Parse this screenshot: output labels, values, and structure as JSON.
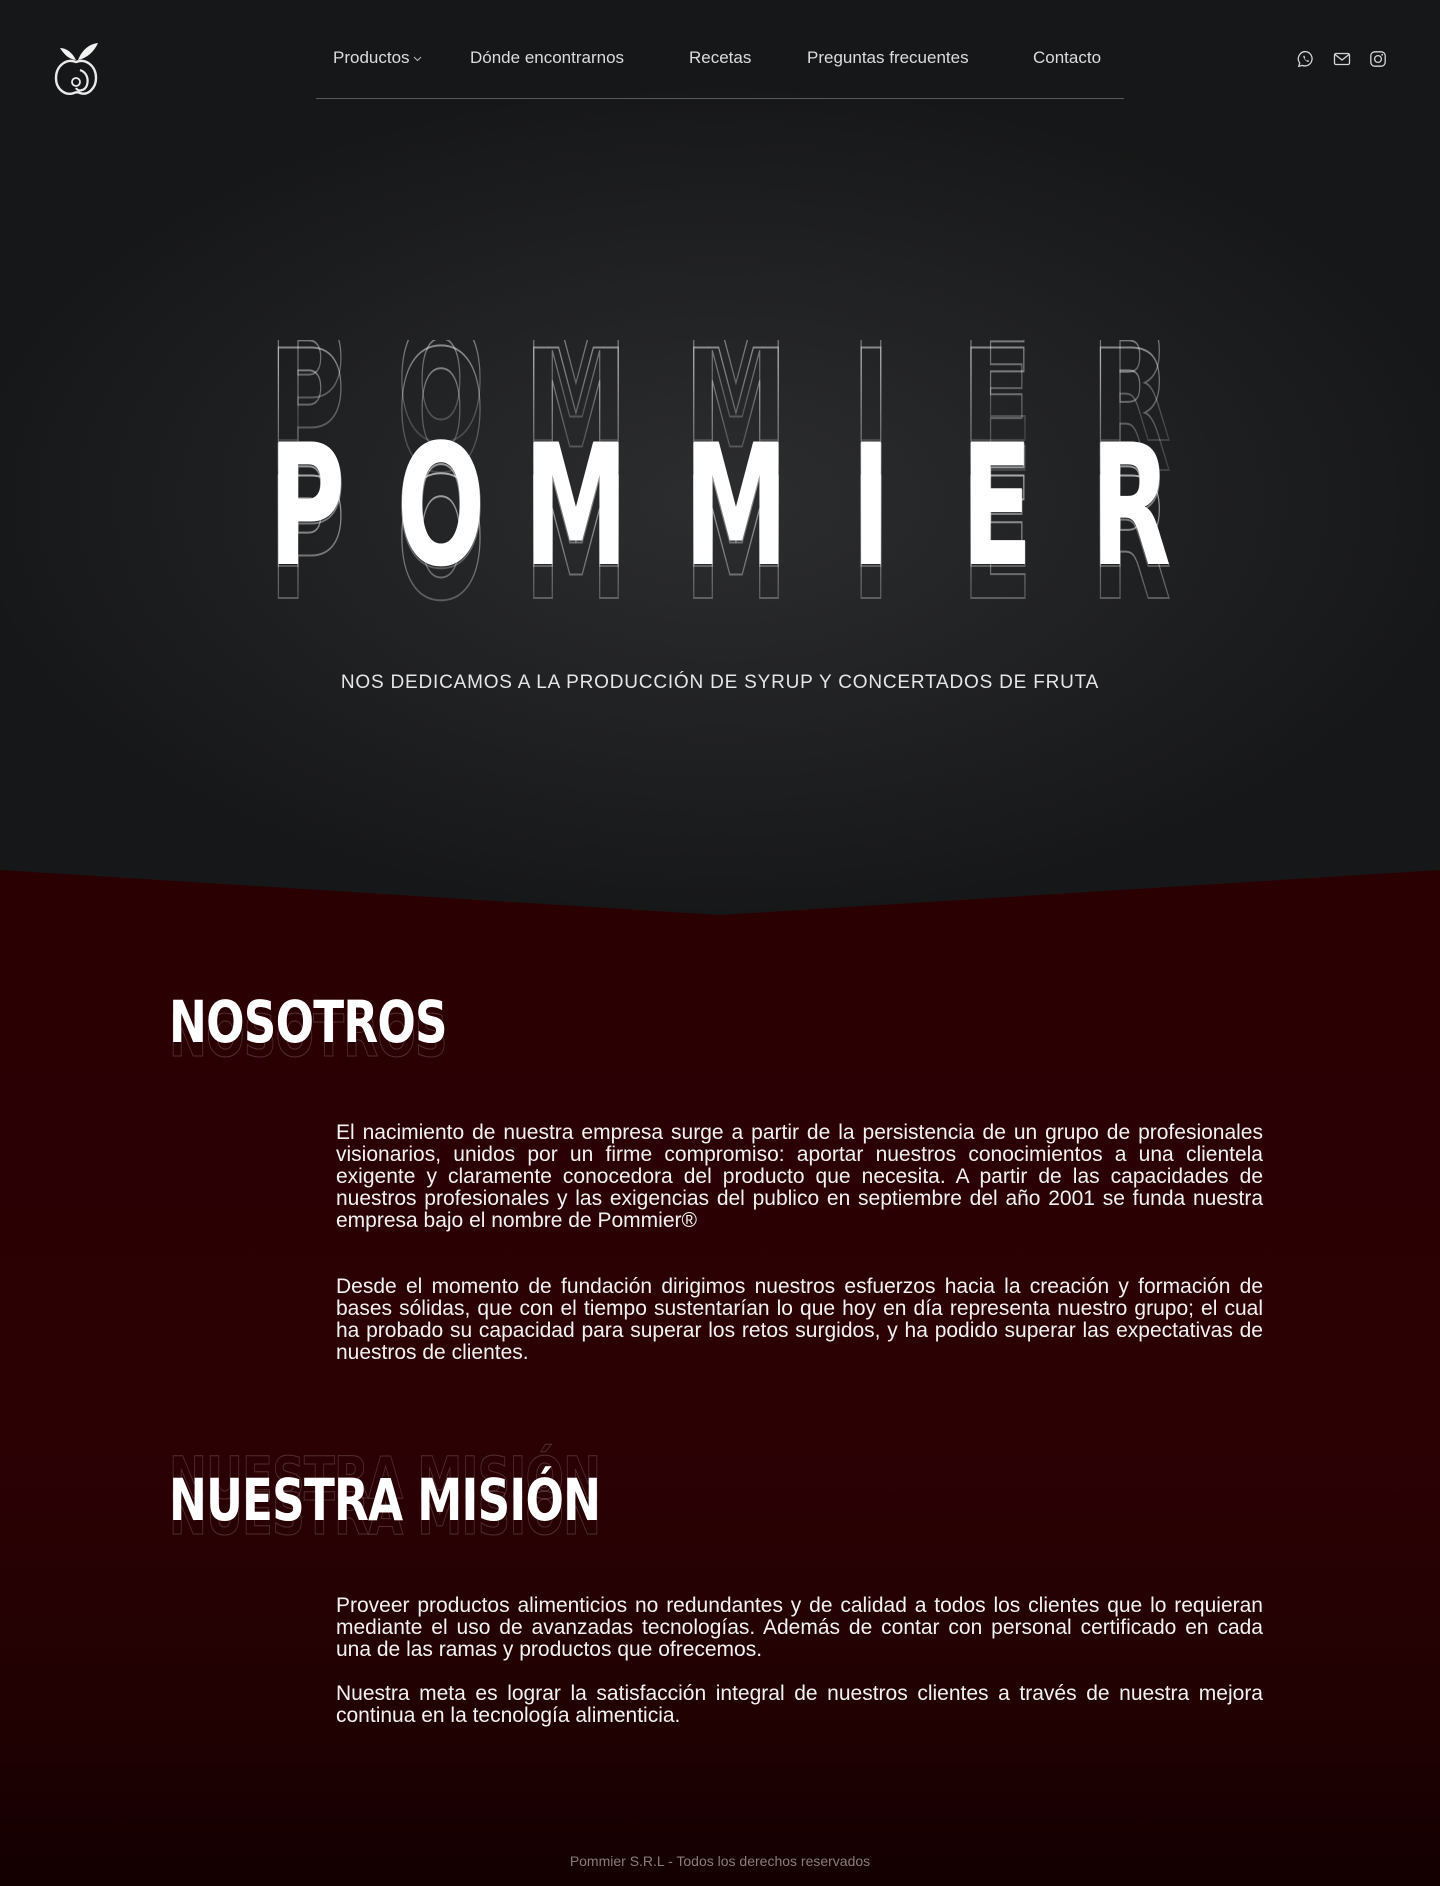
{
  "nav": {
    "items": [
      {
        "label": "Productos",
        "has_dropdown": true
      },
      {
        "label": "Dónde encontrarnos"
      },
      {
        "label": "Recetas"
      },
      {
        "label": "Preguntas frecuentes"
      },
      {
        "label": "Contacto"
      }
    ],
    "social_icons": [
      "whatsapp-icon",
      "mail-icon",
      "instagram-icon"
    ]
  },
  "hero": {
    "brand": "POMMIER",
    "tagline": "NOS DEDICAMOS A LA PRODUCCIÓN DE SYRUP Y CONCERTADOS DE FRUTA"
  },
  "about": {
    "title": "NOSOTROS",
    "paragraphs": [
      "El nacimiento de nuestra empresa surge a partir de la persistencia de un grupo de profesionales visionarios, unidos por un firme compromiso: aportar nuestros conocimientos a una clientela exigente y claramente conocedora del producto que necesita. A partir de las capacidades de nuestros profesionales y las exigencias del publico en septiembre del año 2001 se funda nuestra empresa bajo el nombre de Pommier®",
      "Desde el momento de fundación dirigimos nuestros esfuerzos hacia la creación y formación de bases sólidas, que con el tiempo sustentarían lo que hoy en día representa nuestro grupo; el cual ha probado su capacidad para superar los retos surgidos, y ha podido superar las expectativas de nuestros de clientes."
    ]
  },
  "mission": {
    "title": "NUESTRA MISIÓN",
    "paragraphs": [
      "Proveer productos alimenticios no redundantes y de calidad a todos los clientes que lo requieran mediante el uso de avanzadas tecnologías. Además de contar con personal certificado en cada una de las ramas y productos que ofrecemos.",
      "Nuestra meta es lograr la satisfacción integral de nuestros clientes a través de nuestra mejora continua en la tecnología alimenticia."
    ]
  },
  "footer": {
    "text": "Pommier S.R.L - Todos los derechos reservados"
  },
  "colors": {
    "hero_bg": "#202123",
    "section_bg": "#2a0003",
    "text": "#ffffff"
  }
}
